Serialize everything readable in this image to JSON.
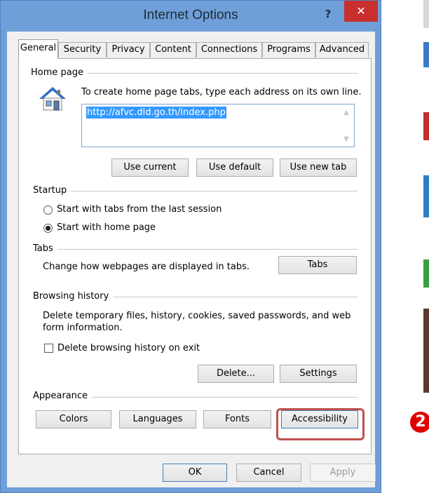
{
  "window": {
    "title": "Internet Options",
    "help_label": "?",
    "close_label": "✕"
  },
  "tabs": [
    {
      "label": "General",
      "active": true
    },
    {
      "label": "Security"
    },
    {
      "label": "Privacy"
    },
    {
      "label": "Content"
    },
    {
      "label": "Connections"
    },
    {
      "label": "Programs"
    },
    {
      "label": "Advanced"
    }
  ],
  "home_page": {
    "group_label": "Home page",
    "icon": "house-icon",
    "description": "To create home page tabs, type each address on its own line.",
    "url_value": "http://afvc.dld.go.th/index.php",
    "use_current_label": "Use current",
    "use_default_label": "Use default",
    "use_new_tab_label": "Use new tab"
  },
  "startup": {
    "group_label": "Startup",
    "option_last_session": "Start with tabs from the last session",
    "option_home_page": "Start with home page",
    "selected": "home_page"
  },
  "tabs_section": {
    "group_label": "Tabs",
    "description": "Change how webpages are displayed in tabs.",
    "tabs_button_label": "Tabs"
  },
  "browsing_history": {
    "group_label": "Browsing history",
    "description_line1": "Delete temporary files, history, cookies, saved passwords, and web",
    "description_line2": "form information.",
    "delete_on_exit_label": "Delete browsing history on exit",
    "delete_on_exit_checked": false,
    "delete_button_label": "Delete...",
    "settings_button_label": "Settings"
  },
  "appearance": {
    "group_label": "Appearance",
    "colors_label": "Colors",
    "languages_label": "Languages",
    "fonts_label": "Fonts",
    "accessibility_label": "Accessibility"
  },
  "footer": {
    "ok_label": "OK",
    "cancel_label": "Cancel",
    "apply_label": "Apply"
  },
  "annotation": {
    "step_number": "2",
    "highlight_color": "#c0504d",
    "badge_color": "#e00000"
  }
}
